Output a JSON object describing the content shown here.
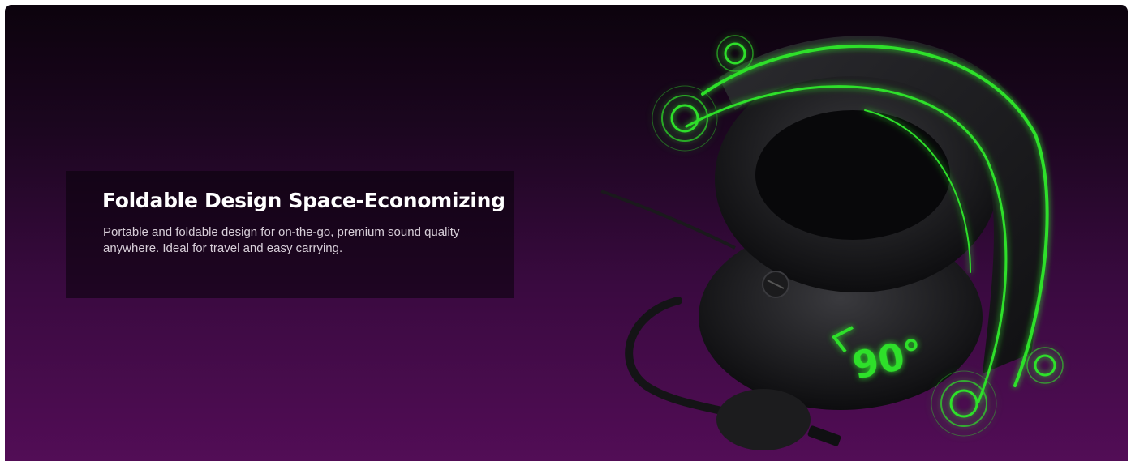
{
  "feature": {
    "title": "Foldable Design Space-Economizing",
    "description": "Portable and foldable design for on-the-go, premium sound quality anywhere. Ideal for travel and easy carrying."
  },
  "product_image": {
    "angle_label": "90°",
    "accent_color": "#2fe02a",
    "icon": "folded-headset-image"
  },
  "colors": {
    "background_top": "#0c030d",
    "background_bottom": "#520d56",
    "headline": "#ffffff",
    "body_text": "#d8cfd9"
  }
}
